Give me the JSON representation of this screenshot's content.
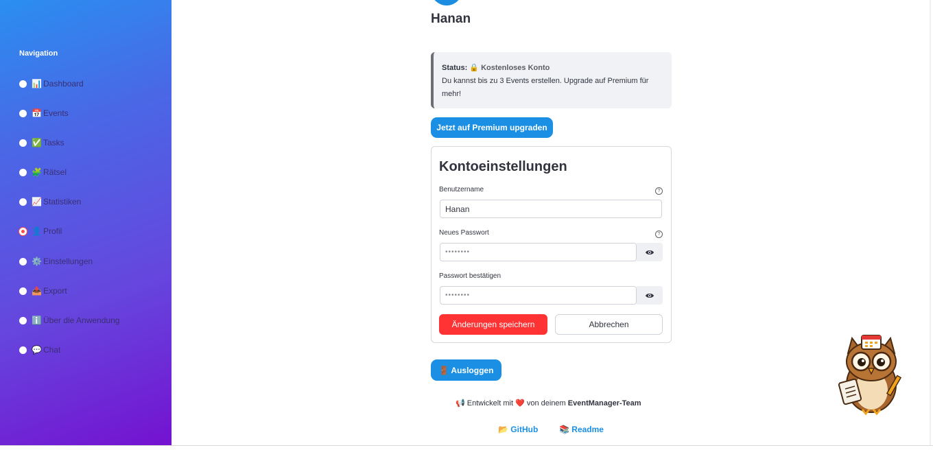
{
  "sidebar": {
    "title": "Navigation",
    "items": [
      {
        "emoji": "📊",
        "label": "Dashboard",
        "selected": false
      },
      {
        "emoji": "📅",
        "label": "Events",
        "selected": false
      },
      {
        "emoji": "✅",
        "label": "Tasks",
        "selected": false
      },
      {
        "emoji": "🧩",
        "label": "Rätsel",
        "selected": false
      },
      {
        "emoji": "📈",
        "label": "Statistiken",
        "selected": false
      },
      {
        "emoji": "👤",
        "label": "Profil",
        "selected": true
      },
      {
        "emoji": "⚙️",
        "label": "Einstellungen",
        "selected": false
      },
      {
        "emoji": "📤",
        "label": "Export",
        "selected": false
      },
      {
        "emoji": "ℹ️",
        "label": "Über die Anwendung",
        "selected": false
      },
      {
        "emoji": "💬",
        "label": "Chat",
        "selected": false
      }
    ]
  },
  "profile": {
    "username": "Hanan"
  },
  "status": {
    "prefix": "Status:",
    "emoji": "🔒",
    "account_type": "Kostenloses Konto",
    "message": "Du kannst bis zu 3 Events erstellen. Upgrade auf Premium für mehr!"
  },
  "upgrade_button": "Jetzt auf Premium upgraden",
  "account_settings": {
    "title": "Kontoeinstellungen",
    "username_label": "Benutzername",
    "username_value": "Hanan",
    "new_password_label": "Neues Passwort",
    "new_password_value": "••••••••",
    "confirm_password_label": "Passwort bestätigen",
    "confirm_password_value": "••••••••",
    "save_button": "Änderungen speichern",
    "cancel_button": "Abbrechen"
  },
  "logout_button": "🚪 Ausloggen",
  "footer": {
    "megaphone": "📢",
    "developed_prefix": "Entwickelt mit",
    "heart": "❤️",
    "developed_mid": "von deinem",
    "team": "EventManager-Team",
    "github_emoji": "📂",
    "github_label": "GitHub",
    "readme_emoji": "📚",
    "readme_label": "Readme"
  },
  "colors": {
    "accent_blue": "#1a8fe3",
    "save_red": "#ff3333",
    "sidebar_gradient_top": "#2a8ff0",
    "sidebar_gradient_bottom": "#7412d0"
  }
}
